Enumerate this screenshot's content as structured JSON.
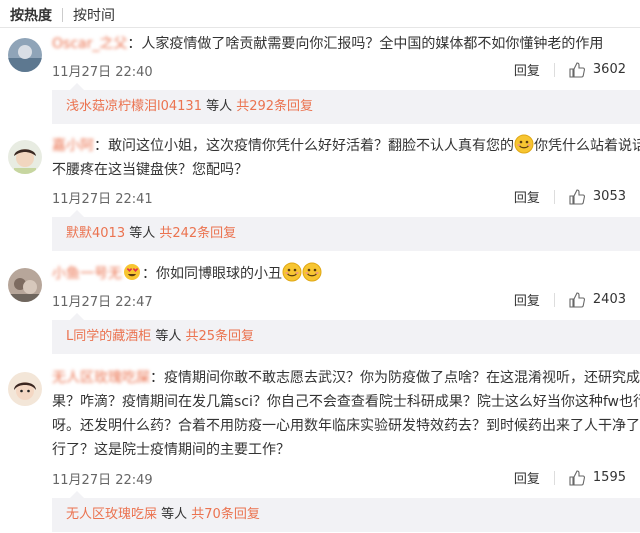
{
  "tabs": {
    "hot": "按热度",
    "time": "按时间"
  },
  "comments": [
    {
      "name": "Oscar_之父",
      "sep": "：",
      "lines": [
        "人家疫情做了啥贡献需要向你汇报吗？全中国的媒体都不如你懂钟老的作用"
      ],
      "time": "11月27日 22:40",
      "reply": "回复",
      "likes": "3602",
      "replies_user": "浅水菇凉柠檬泪l04131",
      "replies_mid": " 等人 ",
      "replies_count": "共292条回复"
    },
    {
      "name": "嘉小阿",
      "sep": "：",
      "lines": [
        "敢问这位小姐，这次疫情你凭什么好好活着？翻脸不认人真有您的",
        "你凭什么站着说话",
        "不腰疼在这当键盘侠？您配吗？"
      ],
      "time": "11月27日 22:41",
      "reply": "回复",
      "likes": "3053",
      "replies_user": "默默4013",
      "replies_mid": " 等人 ",
      "replies_count": "共242条回复"
    },
    {
      "name": "小鱼一号无",
      "sep": "：",
      "lines": [
        "你如同博眼球的小丑"
      ],
      "time": "11月27日 22:47",
      "reply": "回复",
      "likes": "2403",
      "replies_user": "L同学的藏酒柜",
      "replies_mid": " 等人 ",
      "replies_count": "共25条回复"
    },
    {
      "name": "无人区玫瑰吃屎",
      "sep": "：",
      "lines": [
        "疫情期间你敢不敢志愿去武汉？你为防疫做了点啥？在这混淆视听，还研究成",
        "果？咋滴？疫情期间在发几篇sci？你自己不会查查看院士科研成果？院士这么好当你这种fw也行",
        "呀。还发明什么药？合着不用防疫一心用数年临床实验研发特效药去？到时候药出来了人干净了就",
        "行了？这是院士疫情期间的主要工作？"
      ],
      "time": "11月27日 22:49",
      "reply": "回复",
      "likes": "1595",
      "replies_user": "无人区玫瑰吃屎",
      "replies_mid": " 等人 ",
      "replies_count": "共70条回复"
    }
  ],
  "colors": {
    "username": "#eb7350",
    "reply_bg": "#f2f2f5",
    "divider": "#e6e6e6"
  },
  "icons": {
    "like": "thumb-up-icon",
    "emoji": "smiley-emoji-icon",
    "heart_emoji": "heart-eyes-emoji-icon"
  }
}
